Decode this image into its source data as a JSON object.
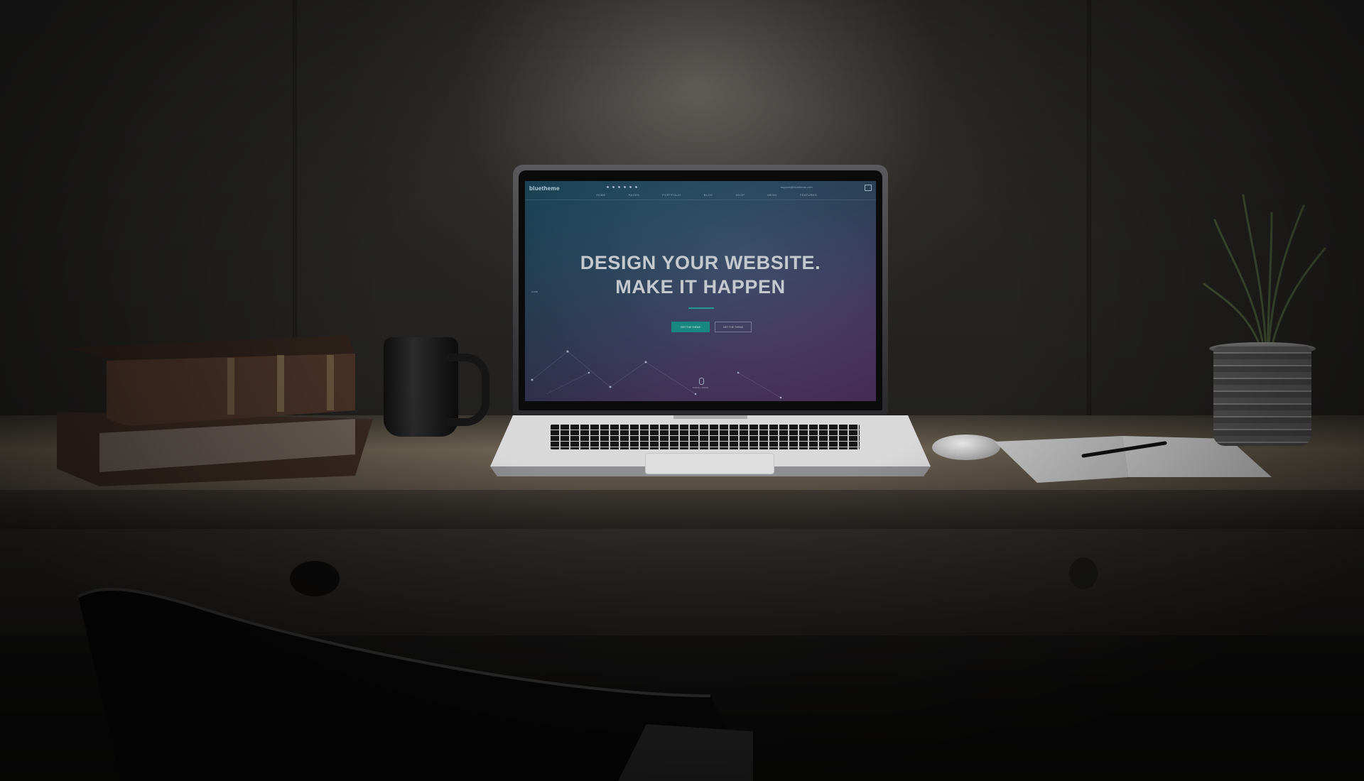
{
  "website": {
    "brand": "bluetheme",
    "email": "support@bluetheme.com",
    "nav": [
      "HOME",
      "PAGES",
      "PORTFOLIO",
      "BLOG",
      "SHOP",
      "MENU",
      "FEATURES"
    ],
    "side_label": "HOME",
    "headline_line1": "DESIGN YOUR WEBSITE.",
    "headline_line2": "MAKE IT HAPPEN",
    "button_primary": "GET THE THEME",
    "button_secondary": "GET THE THEME",
    "scroll_label": "SCROLL DOWN"
  },
  "colors": {
    "accent": "#18877f",
    "screen_top": "#1c4f66",
    "screen_bottom": "#563468",
    "wall": "#2a2927",
    "desk": "#5a5146"
  }
}
